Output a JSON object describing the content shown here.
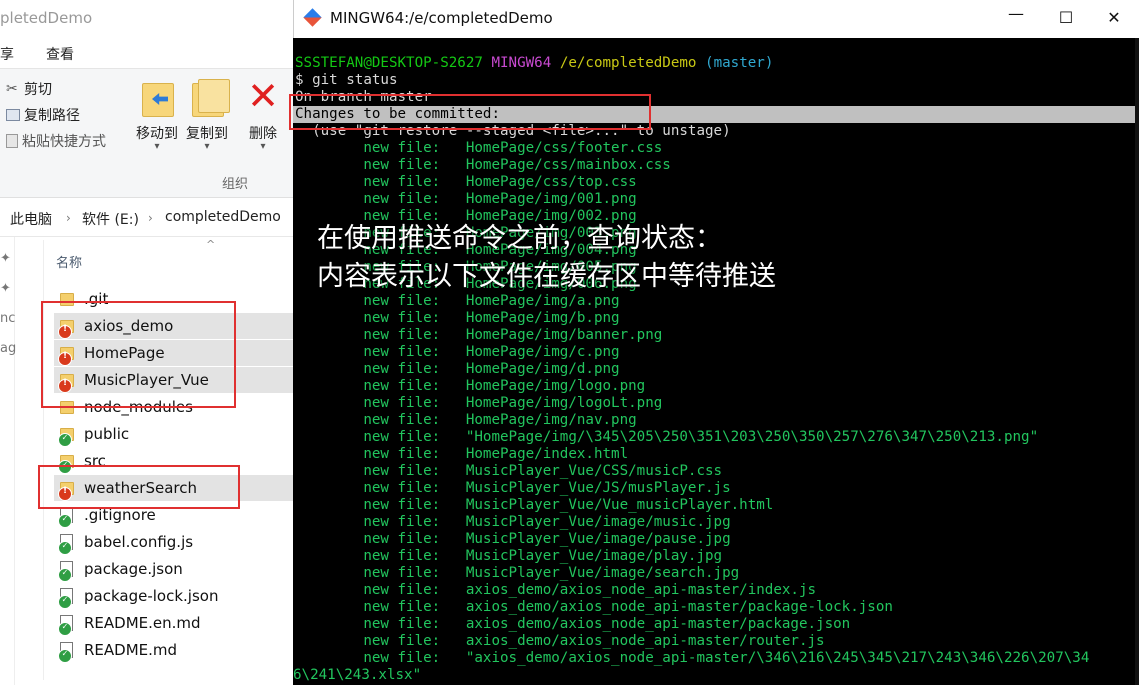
{
  "explorer": {
    "title": "pletedDemo",
    "menu": [
      "享",
      "查看"
    ],
    "ribbon": {
      "cut": "剪切",
      "copy_path": "复制路径",
      "paste_shortcut": "粘贴快捷方式",
      "move_to": "移动到",
      "copy_to": "复制到",
      "delete": "删除",
      "group": "组织"
    },
    "breadcrumb": [
      "此电脑",
      "软件 (E:)",
      "completedDemo"
    ],
    "nav_fragments": [
      "nc",
      "ag"
    ],
    "column_header": "名称",
    "files": [
      {
        "name": ".git",
        "icon": "folder",
        "status": "none",
        "selected": false
      },
      {
        "name": "axios_demo",
        "icon": "folder",
        "status": "modified",
        "selected": true
      },
      {
        "name": "HomePage",
        "icon": "folder",
        "status": "modified",
        "selected": true
      },
      {
        "name": "MusicPlayer_Vue",
        "icon": "folder",
        "status": "modified",
        "selected": true
      },
      {
        "name": "node_modules",
        "icon": "folder",
        "status": "none",
        "selected": false
      },
      {
        "name": "public",
        "icon": "folder",
        "status": "clean",
        "selected": false
      },
      {
        "name": "src",
        "icon": "folder",
        "status": "clean",
        "selected": false
      },
      {
        "name": "weatherSearch",
        "icon": "folder",
        "status": "modified",
        "selected": true
      },
      {
        "name": ".gitignore",
        "icon": "file",
        "status": "clean",
        "selected": false
      },
      {
        "name": "babel.config.js",
        "icon": "file",
        "status": "clean",
        "selected": false
      },
      {
        "name": "package.json",
        "icon": "file",
        "status": "clean",
        "selected": false
      },
      {
        "name": "package-lock.json",
        "icon": "file",
        "status": "clean",
        "selected": false
      },
      {
        "name": "README.en.md",
        "icon": "file",
        "status": "clean",
        "selected": false
      },
      {
        "name": "README.md",
        "icon": "file",
        "status": "clean",
        "selected": false
      }
    ]
  },
  "terminal": {
    "title": "MINGW64:/e/completedDemo",
    "prompt": {
      "user": "SSSTEFAN@DESKTOP-S2627",
      "sys": "MINGW64",
      "path": "/e/completedDemo",
      "branch": "(master)"
    },
    "command": "$ git status",
    "branch_line": "On branch master",
    "changes_header": "Changes to be committed:",
    "hint": "  (use \"git restore --staged <file>...\" to unstage)",
    "label": "new file:",
    "entries": [
      "HomePage/css/footer.css",
      "HomePage/css/mainbox.css",
      "HomePage/css/top.css",
      "HomePage/img/001.png",
      "HomePage/img/002.png",
      "HomePage/img/003.png",
      "HomePage/img/004.png",
      "HomePage/img/005.png",
      "HomePage/img/006.png",
      "HomePage/img/a.png",
      "HomePage/img/b.png",
      "HomePage/img/banner.png",
      "HomePage/img/c.png",
      "HomePage/img/d.png",
      "HomePage/img/logo.png",
      "HomePage/img/logoLt.png",
      "HomePage/img/nav.png",
      "\"HomePage/img/\\345\\205\\250\\351\\203\\250\\350\\257\\276\\347\\250\\213.png\"",
      "HomePage/index.html",
      "MusicPlayer_Vue/CSS/musicP.css",
      "MusicPlayer_Vue/JS/musPlayer.js",
      "MusicPlayer_Vue/Vue_musicPlayer.html",
      "MusicPlayer_Vue/image/music.jpg",
      "MusicPlayer_Vue/image/pause.jpg",
      "MusicPlayer_Vue/image/play.jpg",
      "MusicPlayer_Vue/image/search.jpg",
      "axios_demo/axios_node_api-master/index.js",
      "axios_demo/axios_node_api-master/package-lock.json",
      "axios_demo/axios_node_api-master/package.json",
      "axios_demo/axios_node_api-master/router.js",
      "\"axios_demo/axios_node_api-master/\\346\\216\\245\\345\\217\\243\\346\\226\\207\\34"
    ],
    "wrap_line": "6\\241\\243.xlsx\"",
    "window_controls": [
      "minimize-icon",
      "maximize-icon",
      "close-icon"
    ]
  },
  "overlay": {
    "line1": "在使用推送命令之前，查询状态：",
    "line2": "内容表示以下文件在缓存区中等待推送"
  },
  "colors": {
    "annotation_box": "#e03030",
    "terminal_bg": "#000000",
    "terminal_green": "#22c55e"
  }
}
